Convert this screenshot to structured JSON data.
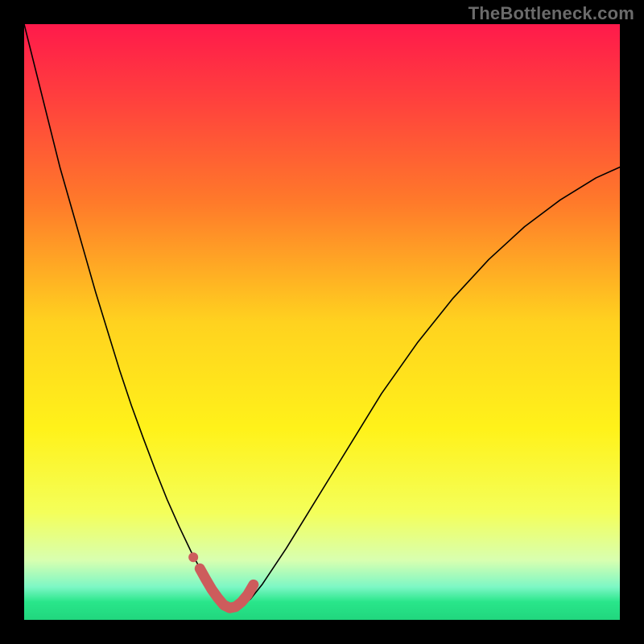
{
  "watermark": "TheBottleneck.com",
  "chart_data": {
    "type": "line",
    "title": "",
    "xlabel": "",
    "ylabel": "",
    "xlim": [
      0,
      100
    ],
    "ylim": [
      0,
      100
    ],
    "background_gradient": {
      "stops": [
        {
          "offset": 0.0,
          "color": "#ff1a4b"
        },
        {
          "offset": 0.12,
          "color": "#ff3e3e"
        },
        {
          "offset": 0.3,
          "color": "#ff7a2a"
        },
        {
          "offset": 0.5,
          "color": "#ffd21f"
        },
        {
          "offset": 0.68,
          "color": "#fff21a"
        },
        {
          "offset": 0.82,
          "color": "#f4ff5a"
        },
        {
          "offset": 0.9,
          "color": "#d8ffb0"
        },
        {
          "offset": 0.945,
          "color": "#7cf7c5"
        },
        {
          "offset": 0.97,
          "color": "#29e68a"
        },
        {
          "offset": 1.0,
          "color": "#21d67e"
        }
      ]
    },
    "series": [
      {
        "name": "bottleneck-curve",
        "color": "#000000",
        "width": 1.6,
        "x": [
          0,
          2,
          4,
          6,
          8,
          10,
          12,
          14,
          16,
          18,
          20,
          22,
          24,
          26,
          28,
          30,
          31,
          32,
          33,
          34,
          36,
          38,
          40,
          44,
          48,
          52,
          56,
          60,
          66,
          72,
          78,
          84,
          90,
          96,
          100
        ],
        "values": [
          100,
          92,
          84,
          76,
          69,
          62,
          55,
          48.5,
          42,
          36,
          30.5,
          25.2,
          20.2,
          15.7,
          11.5,
          7.7,
          5.9,
          4.3,
          3.0,
          2.0,
          2.0,
          3.5,
          6.0,
          12.0,
          18.5,
          25.0,
          31.5,
          38.0,
          46.5,
          54.0,
          60.5,
          66.0,
          70.5,
          74.2,
          76.0
        ]
      },
      {
        "name": "valley-highlight",
        "color": "#cd5c5c",
        "width": 13,
        "x": [
          29.5,
          30.5,
          31.5,
          32.5,
          33.5,
          34.5,
          35.5,
          36.5,
          37.5,
          38.5
        ],
        "values": [
          8.6,
          6.8,
          5.1,
          3.7,
          2.5,
          2.0,
          2.2,
          3.0,
          4.2,
          5.9
        ]
      }
    ],
    "markers": [
      {
        "name": "valley-dot",
        "x": 28.4,
        "y": 10.5,
        "r": 6,
        "color": "#cd5c5c"
      }
    ]
  }
}
